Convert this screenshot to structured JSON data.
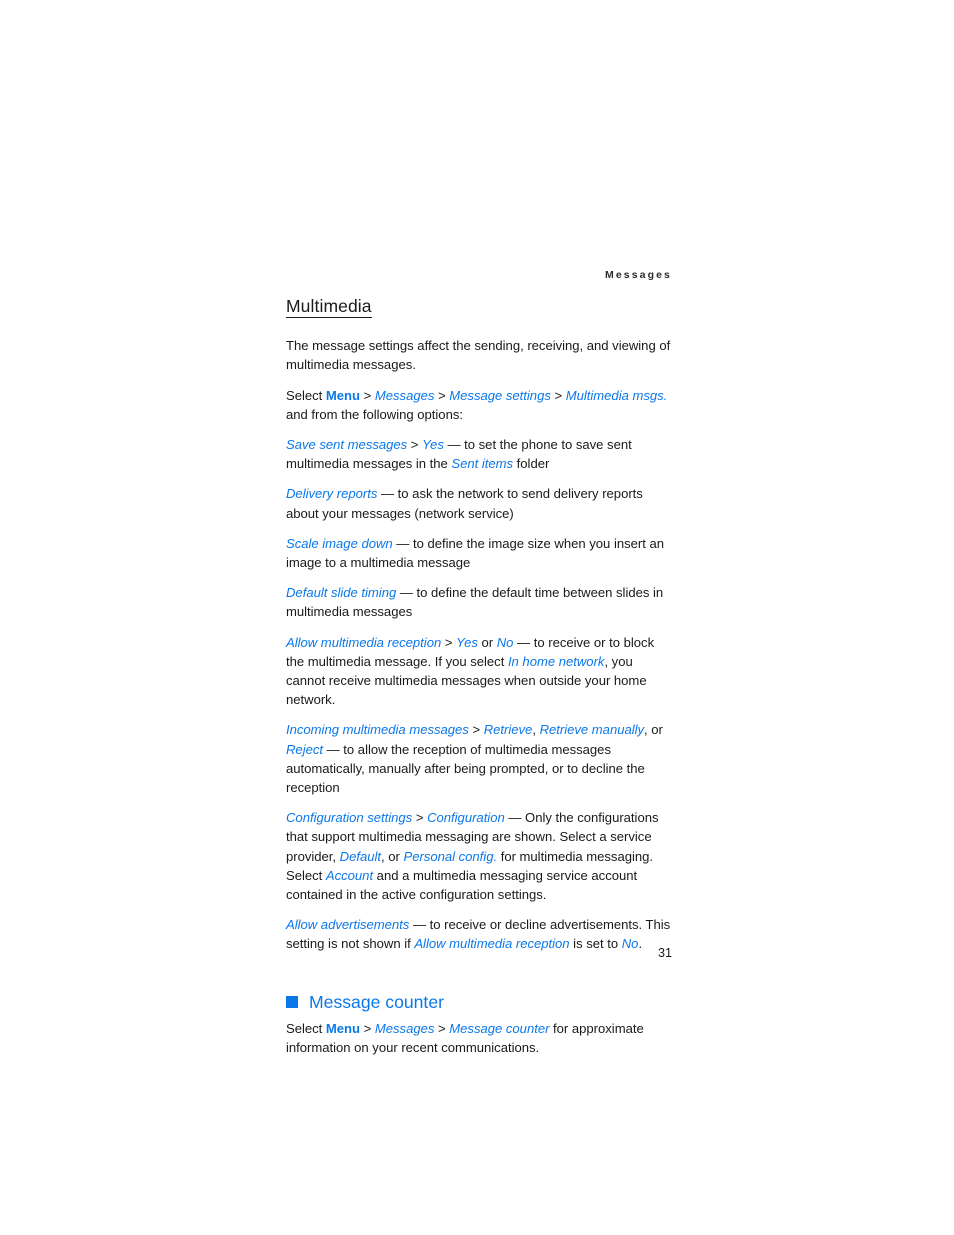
{
  "document": {
    "running_head": "Messages",
    "page_number": "31"
  },
  "section": {
    "title": "Multimedia",
    "intro": "The message settings affect the sending, receiving, and viewing of multimedia messages."
  },
  "path_line": {
    "select": "Select ",
    "menu": "Menu",
    "sep1": " > ",
    "messages": "Messages",
    "sep2": " > ",
    "message_settings": "Message settings",
    "sep3": " > ",
    "multimedia_msgs": "Multimedia msgs.",
    "tail": " and from the following options:"
  },
  "options": [
    {
      "id": "save-sent-messages",
      "term": "Save sent messages",
      "sep": " > ",
      "value": "Yes",
      "desc_a": " — to set the phone to save sent multimedia messages in the ",
      "inline_link": "Sent items",
      "desc_b": " folder"
    },
    {
      "id": "delivery-reports",
      "term": "Delivery reports",
      "desc_a": " — to ask the network to send delivery reports about your messages (network service)"
    },
    {
      "id": "scale-image-down",
      "term": "Scale image down",
      "desc_a": " — to define the image size when you insert an image to a multimedia message"
    },
    {
      "id": "default-slide-timing",
      "term": "Default slide timing",
      "desc_a": " — to define the default time between slides in multimedia messages"
    },
    {
      "id": "allow-multimedia-reception",
      "term": "Allow multimedia reception",
      "sep": " > ",
      "value": "Yes",
      "mid": " or ",
      "value2": "No",
      "desc_a": " — to receive or to block the multimedia message. If you select ",
      "inline_link": "In home network",
      "desc_b": ", you cannot receive multimedia messages when outside your home network."
    },
    {
      "id": "incoming-multimedia-messages",
      "term": "Incoming multimedia messages",
      "sep": " > ",
      "value": "Retrieve",
      "mid": ", ",
      "value2": "Retrieve manually",
      "mid2": ", or ",
      "value3": "Reject",
      "desc_a": " — to allow the reception of multimedia messages automatically, manually after being prompted, or to decline the reception"
    },
    {
      "id": "configuration-settings",
      "term": "Configuration settings",
      "sep": " > ",
      "value": "Configuration",
      "desc_a": " — Only the configurations that support multimedia messaging are shown. Select a service provider, ",
      "inline_link": "Default",
      "desc_b": ", or ",
      "inline_link2": "Personal config.",
      "desc_c": " for multimedia messaging. Select ",
      "inline_link3": "Account",
      "desc_d": " and a multimedia messaging service account contained in the active configuration settings."
    },
    {
      "id": "allow-advertisements",
      "term": "Allow advertisements",
      "desc_a": " — to receive or decline advertisements. This setting is not shown if ",
      "inline_link": "Allow multimedia reception",
      "desc_b": " is set to ",
      "inline_link2": "No",
      "desc_c": "."
    }
  ],
  "message_counter": {
    "heading": "Message counter",
    "select": "Select ",
    "menu": "Menu",
    "sep1": " > ",
    "messages": "Messages",
    "sep2": " > ",
    "message_counter": "Message counter",
    "tail": " for approximate information on your recent communications."
  },
  "colors": {
    "link_blue": "#0b78ea",
    "body_text": "#1a1a1a",
    "background": "#ffffff"
  }
}
